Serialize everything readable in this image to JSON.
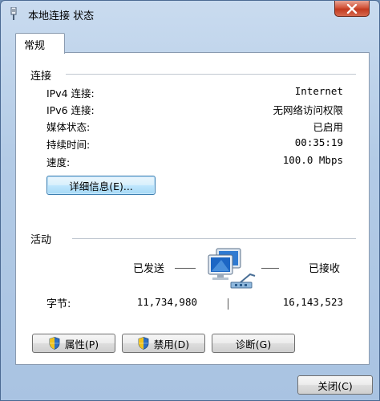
{
  "window": {
    "title": "本地连接 状态",
    "icons": {
      "title": "network-adapter-icon",
      "close": "close-x-icon"
    }
  },
  "tabs": [
    {
      "label": "常规",
      "selected": true
    }
  ],
  "connection": {
    "section_title": "连接",
    "rows": [
      {
        "label": "IPv4 连接:",
        "value": "Internet"
      },
      {
        "label": "IPv6 连接:",
        "value": "无网络访问权限"
      },
      {
        "label": "媒体状态:",
        "value": "已启用"
      },
      {
        "label": "持续时间:",
        "value": "00:35:19"
      },
      {
        "label": "速度:",
        "value": "100.0 Mbps"
      }
    ],
    "details_button": "详细信息(E)..."
  },
  "activity": {
    "section_title": "活动",
    "sent_label": "已发送",
    "received_label": "已接收",
    "bytes_label": "字节:",
    "bytes_sent": "11,734,980",
    "bytes_received": "16,143,523",
    "icon": "network-computers-icon"
  },
  "buttons": {
    "properties": "属性(P)",
    "disable": "禁用(D)",
    "diagnose": "诊断(G)",
    "close": "关闭(C)"
  },
  "colors": {
    "title_bar": "#b3cbe6",
    "close_button": "#c23a1f",
    "focused_button": "#3c7fb1"
  }
}
